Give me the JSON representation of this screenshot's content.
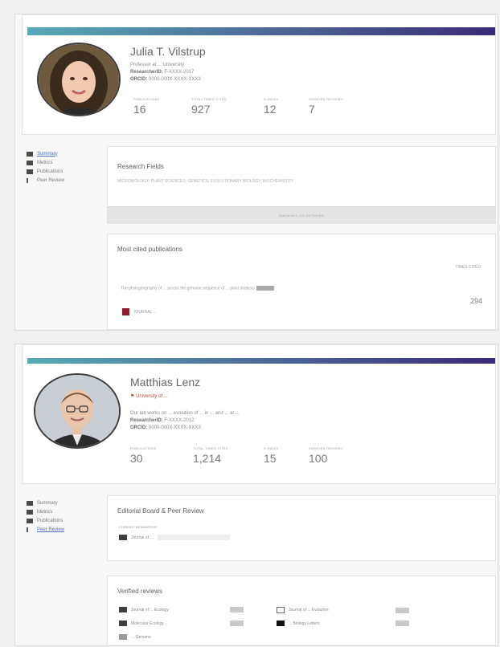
{
  "profile1": {
    "name": "Julia T. Vilstrup",
    "title_line": "Professor at ... University",
    "research_id_label": "ResearcherID:",
    "research_id_value": "F-XXXX-2017",
    "orcid_label": "ORCID:",
    "orcid_value": "0000-000X-XXXX-XXXX",
    "stats": [
      {
        "label": "PUBLICATIONS",
        "value": "16"
      },
      {
        "label": "TOTAL TIMES CITED",
        "value": "927"
      },
      {
        "label": "H-INDEX",
        "value": "12"
      },
      {
        "label": "VERIFIED REVIEWS",
        "value": "7"
      }
    ],
    "nav": [
      {
        "label": "Summary",
        "active": true
      },
      {
        "label": "Metrics",
        "active": false
      },
      {
        "label": "Publications",
        "active": false
      },
      {
        "label": "Peer Review",
        "active": false
      }
    ],
    "research_fields_title": "Research Fields",
    "research_fields_text": "MICROBIOLOGY; PLANT SCIENCES; GENETICS; EVOLUTIONARY BIOLOGY; BIOCHEMISTRY",
    "fields_footer": "SHOW ALL CO-AUTHORS",
    "most_cited_title": "Most cited publications",
    "times_cited_label": "TIMES CITED",
    "pub_text": "The phylogeography of ... across the genome sequence of ... plant analysis",
    "pub_sub": "JOURNAL ...",
    "pub_count": "294"
  },
  "profile2": {
    "name": "Matthias Lenz",
    "affiliation": "University of ...",
    "desc_line": "Our lab works on ... evolution of ... in ... and ... at ...",
    "research_id_label": "ResearcherID:",
    "research_id_value": "F-XXXX-2012",
    "orcid_label": "ORCID:",
    "orcid_value": "0000-000X-XXXX-XXXX",
    "stats": [
      {
        "label": "PUBLICATIONS",
        "value": "30"
      },
      {
        "label": "TOTAL TIMES CITED",
        "value": "1,214"
      },
      {
        "label": "H-INDEX",
        "value": "15"
      },
      {
        "label": "VERIFIED REVIEWS",
        "value": "100"
      }
    ],
    "nav": [
      {
        "label": "Summary",
        "active": false
      },
      {
        "label": "Metrics",
        "active": false
      },
      {
        "label": "Publications",
        "active": false
      },
      {
        "label": "Peer Review",
        "active": true
      }
    ],
    "editor_title": "Editorial Board & Peer Review",
    "editor_sub": "CURRENT MEMBERSHIP",
    "editor_item": "Journal of ...",
    "verified_title": "Verified reviews",
    "reviews": [
      {
        "name": "Journal of ... Ecology"
      },
      {
        "name": "Molecular Ecology"
      },
      {
        "name": "... Genome"
      },
      {
        "name": "Journal of ... Evolution"
      },
      {
        "name": "... Biology Letters"
      }
    ]
  },
  "colors": {
    "accent_start": "#57aab6",
    "accent_end": "#3b2a78",
    "link": "#4a72b6",
    "affiliation": "#b84a3b"
  }
}
